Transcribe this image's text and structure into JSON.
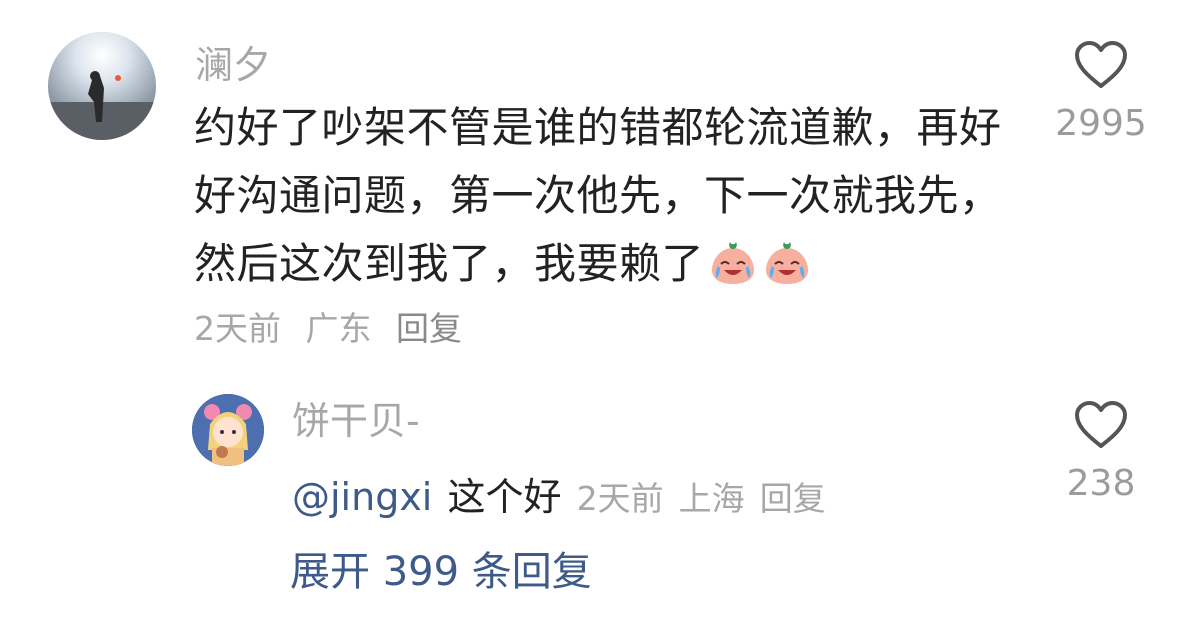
{
  "comment": {
    "username": "澜夕",
    "text_lines": [
      "约好了吵架不管是谁的错都轮流道歉，再好",
      "好沟通问题，第一次他先，下一次就我先，",
      "然后这次到我了，我要赖了"
    ],
    "emojis": [
      "crying-laughing-peach-emoji",
      "crying-laughing-peach-emoji"
    ],
    "time": "2天前",
    "location": "广东",
    "reply_label": "回复",
    "likes": "2995"
  },
  "reply": {
    "username": "饼干贝-",
    "mention": "@jingxi",
    "text": "这个好",
    "time": "2天前",
    "location": "上海",
    "reply_label": "回复",
    "likes": "238"
  },
  "expand_label": "展开 399 条回复",
  "colors": {
    "link": "#3d5a8a",
    "muted": "#a7a7a7",
    "text": "#222222"
  }
}
